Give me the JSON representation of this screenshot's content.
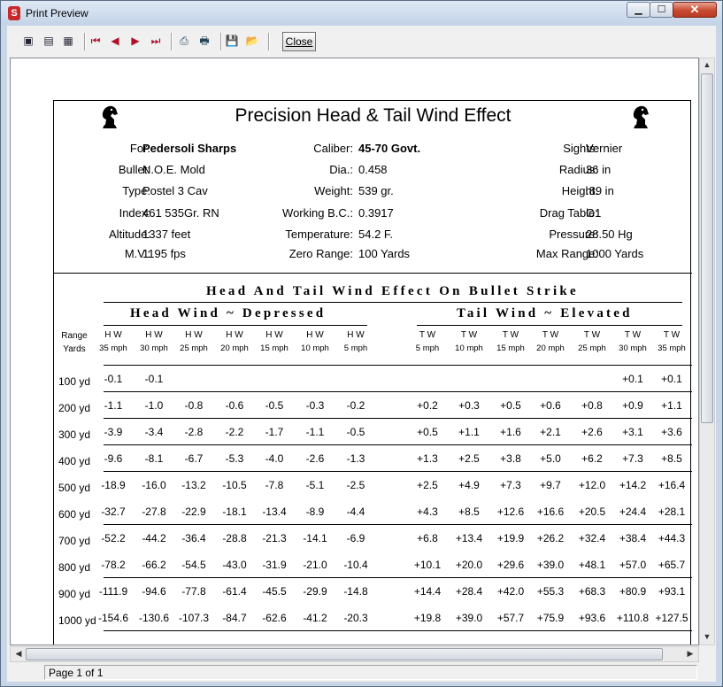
{
  "window": {
    "title": "Print Preview",
    "close_label": "Close",
    "status": "Page 1 of 1",
    "toolbar_icons": [
      "one-page-icon",
      "two-page-icon",
      "multi-page-icon",
      "first-page-icon",
      "prev-page-icon",
      "next-page-icon",
      "last-page-icon",
      "print-setup-icon",
      "print-icon",
      "save-icon",
      "open-icon"
    ]
  },
  "report": {
    "title": "Precision Head & Tail Wind Effect",
    "info": {
      "left": [
        {
          "label": "For:",
          "value": "Pedersoli Sharps",
          "bold": true
        },
        {
          "label": "Bullet:",
          "value": "N.O.E. Mold"
        },
        {
          "label": "Type:",
          "value": "Postel 3 Cav"
        },
        {
          "label": "Index:",
          "value": "461 535Gr. RN"
        },
        {
          "label": "Altitude:",
          "value": "1337 feet"
        },
        {
          "label": "M.V.:",
          "value": "1195  fps"
        }
      ],
      "middle": [
        {
          "label": "Caliber:",
          "value": "45-70 Govt.",
          "bold": true
        },
        {
          "label": "Dia.:",
          "value": "0.458"
        },
        {
          "label": "Weight:",
          "value": "539 gr."
        },
        {
          "label": "Working B.C.:",
          "value": "0.3917"
        },
        {
          "label": "Temperature:",
          "value": "54.2 F."
        },
        {
          "label": "Zero Range:",
          "value": "100   Yards"
        }
      ],
      "right": [
        {
          "label": "Sights:",
          "value": "Vernier"
        },
        {
          "label": "Radius:",
          "value": "36   in"
        },
        {
          "label": "Height:",
          "value": ".89   in"
        },
        {
          "label": "Drag Table:",
          "value": "G1"
        },
        {
          "label": "Pressure:",
          "value": "28.50 Hg"
        },
        {
          "label": "Max Range:",
          "value": "1000 Yards"
        }
      ]
    },
    "table_title": "Head And Tail Wind Effect On Bullet Strike",
    "head_title": "Head Wind ~ Depressed",
    "tail_title": "Tail Wind ~ Elevated",
    "range_label": [
      "Range",
      "Yards"
    ],
    "head_cols": [
      {
        "a": "H W",
        "b": "35 mph"
      },
      {
        "a": "H W",
        "b": "30 mph"
      },
      {
        "a": "H W",
        "b": "25 mph"
      },
      {
        "a": "H W",
        "b": "20 mph"
      },
      {
        "a": "H W",
        "b": "15 mph"
      },
      {
        "a": "H W",
        "b": "10 mph"
      },
      {
        "a": "H W",
        "b": "5 mph"
      }
    ],
    "tail_cols": [
      {
        "a": "T W",
        "b": "5 mph"
      },
      {
        "a": "T W",
        "b": "10 mph"
      },
      {
        "a": "T W",
        "b": "15 mph"
      },
      {
        "a": "T W",
        "b": "20 mph"
      },
      {
        "a": "T W",
        "b": "25 mph"
      },
      {
        "a": "T W",
        "b": "30 mph"
      },
      {
        "a": "T W",
        "b": "35 mph"
      }
    ],
    "rows": [
      {
        "range": "100 yd",
        "head": [
          "-0.1",
          "-0.1",
          "",
          "",
          "",
          "",
          ""
        ],
        "tail": [
          "",
          "",
          "",
          "",
          "",
          "+0.1",
          "+0.1"
        ]
      },
      {
        "range": "200 yd",
        "head": [
          "-1.1",
          "-1.0",
          "-0.8",
          "-0.6",
          "-0.5",
          "-0.3",
          "-0.2"
        ],
        "tail": [
          "+0.2",
          "+0.3",
          "+0.5",
          "+0.6",
          "+0.8",
          "+0.9",
          "+1.1"
        ]
      },
      {
        "range": "300 yd",
        "head": [
          "-3.9",
          "-3.4",
          "-2.8",
          "-2.2",
          "-1.7",
          "-1.1",
          "-0.5"
        ],
        "tail": [
          "+0.5",
          "+1.1",
          "+1.6",
          "+2.1",
          "+2.6",
          "+3.1",
          "+3.6"
        ]
      },
      {
        "range": "400 yd",
        "head": [
          "-9.6",
          "-8.1",
          "-6.7",
          "-5.3",
          "-4.0",
          "-2.6",
          "-1.3"
        ],
        "tail": [
          "+1.3",
          "+2.5",
          "+3.8",
          "+5.0",
          "+6.2",
          "+7.3",
          "+8.5"
        ]
      },
      {
        "range": "500 yd",
        "head": [
          "-18.9",
          "-16.0",
          "-13.2",
          "-10.5",
          "-7.8",
          "-5.1",
          "-2.5"
        ],
        "tail": [
          "+2.5",
          "+4.9",
          "+7.3",
          "+9.7",
          "+12.0",
          "+14.2",
          "+16.4"
        ]
      },
      {
        "range": "600 yd",
        "head": [
          "-32.7",
          "-27.8",
          "-22.9",
          "-18.1",
          "-13.4",
          "-8.9",
          "-4.4"
        ],
        "tail": [
          "+4.3",
          "+8.5",
          "+12.6",
          "+16.6",
          "+20.5",
          "+24.4",
          "+28.1"
        ]
      },
      {
        "range": "700 yd",
        "head": [
          "-52.2",
          "-44.2",
          "-36.4",
          "-28.8",
          "-21.3",
          "-14.1",
          "-6.9"
        ],
        "tail": [
          "+6.8",
          "+13.4",
          "+19.9",
          "+26.2",
          "+32.4",
          "+38.4",
          "+44.3"
        ]
      },
      {
        "range": "800 yd",
        "head": [
          "-78.2",
          "-66.2",
          "-54.5",
          "-43.0",
          "-31.9",
          "-21.0",
          "-10.4"
        ],
        "tail": [
          "+10.1",
          "+20.0",
          "+29.6",
          "+39.0",
          "+48.1",
          "+57.0",
          "+65.7"
        ]
      },
      {
        "range": "900 yd",
        "head": [
          "-111.9",
          "-94.6",
          "-77.8",
          "-61.4",
          "-45.5",
          "-29.9",
          "-14.8"
        ],
        "tail": [
          "+14.4",
          "+28.4",
          "+42.0",
          "+55.3",
          "+68.3",
          "+80.9",
          "+93.1"
        ]
      },
      {
        "range": "1000 yd",
        "head": [
          "-154.6",
          "-130.6",
          "-107.3",
          "-84.7",
          "-62.6",
          "-41.2",
          "-20.3"
        ],
        "tail": [
          "+19.8",
          "+39.0",
          "+57.7",
          "+75.9",
          "+93.6",
          "+110.8",
          "+127.5"
        ]
      }
    ]
  }
}
